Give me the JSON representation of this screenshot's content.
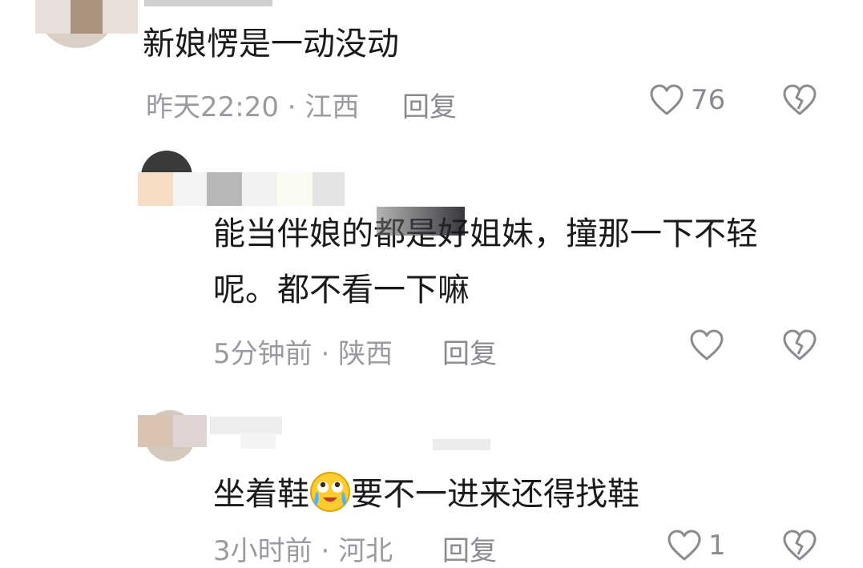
{
  "comments": [
    {
      "text": "新娘愣是一动没动",
      "time": "昨天22:20",
      "location": "江西",
      "reply_label": "回复",
      "likes": "76"
    },
    {
      "text_line1": "能当伴娘的都是好姐妹，撞那一下不轻",
      "text_line2": "呢。都不看一下嘛",
      "time": "5分钟前",
      "location": "陕西",
      "reply_label": "回复",
      "likes": ""
    },
    {
      "text_before": "坐着鞋",
      "emoji": "crying-laughing-emoji",
      "text_after": "要不一进来还得找鞋",
      "time": "3小时前",
      "location": "河北",
      "reply_label": "回复",
      "likes": "1"
    }
  ],
  "separator": " · ",
  "icons": {
    "like": "heart-outline-icon",
    "dislike": "broken-heart-icon"
  },
  "colors": {
    "meta_text": "#9a9aa0",
    "icon_stroke": "#8a8a90"
  }
}
